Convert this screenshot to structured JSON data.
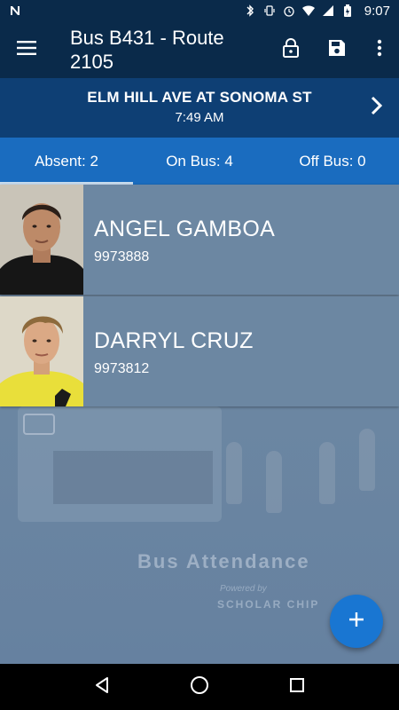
{
  "status_bar": {
    "time": "9:07",
    "icons": [
      "notification-n-icon",
      "bluetooth-icon",
      "vibrate-icon",
      "alarm-icon",
      "wifi-icon",
      "signal-icon",
      "battery-icon"
    ]
  },
  "app_bar": {
    "title": "Bus B431 - Route 2105",
    "menu_icon": "hamburger-menu-icon",
    "actions": [
      "lock-icon",
      "save-icon",
      "more-vert-icon"
    ]
  },
  "stop": {
    "name": "ELM HILL AVE AT SONOMA ST",
    "time": "7:49 AM",
    "next_icon": "chevron-right-icon"
  },
  "tabs": [
    {
      "label": "Absent: 2",
      "active": true
    },
    {
      "label": "On Bus: 4",
      "active": false
    },
    {
      "label": "Off Bus: 0",
      "active": false
    }
  ],
  "students": [
    {
      "name": "ANGEL GAMBOA",
      "id": "9973888"
    },
    {
      "name": "DARRYL CRUZ",
      "id": "9973812"
    }
  ],
  "background": {
    "watermark": "Bus Attendance",
    "powered_by": "Powered by",
    "brand": "SCHOLAR CHIP"
  },
  "fab": {
    "icon": "add-icon"
  },
  "nav": [
    "back-icon",
    "home-icon",
    "recents-icon"
  ],
  "colors": {
    "app_bar": "#0a2a4a",
    "stop_banner": "#0e3f74",
    "tabs": "#1a6cbf",
    "card": "#6c87a2",
    "fab": "#1976d2"
  }
}
